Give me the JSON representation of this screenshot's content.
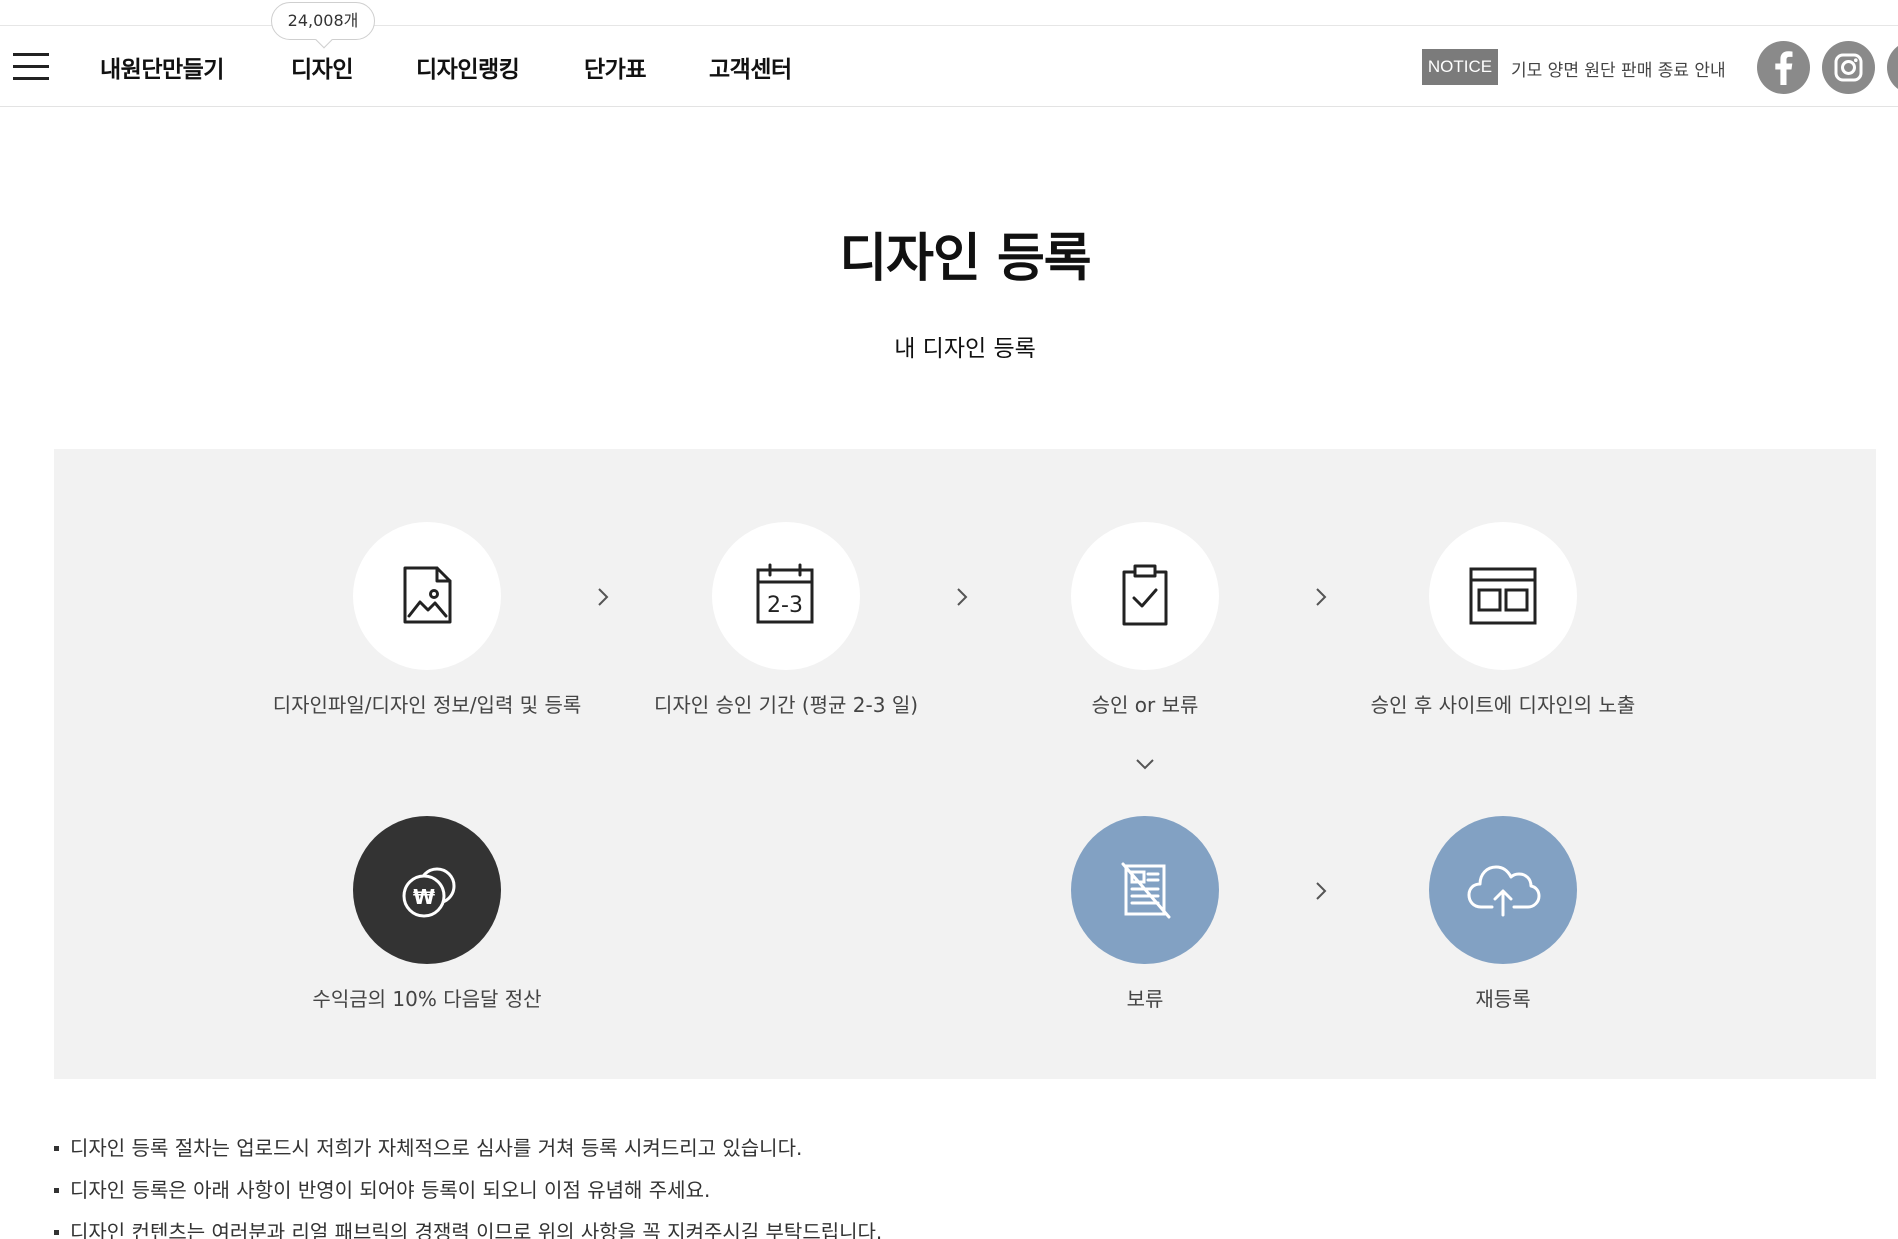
{
  "nav": {
    "items": [
      {
        "label": "내원단만들기"
      },
      {
        "label": "디자인"
      },
      {
        "label": "디자인랭킹"
      },
      {
        "label": "단가표"
      },
      {
        "label": "고객센터"
      }
    ],
    "design_count": "24,008개",
    "notice_badge": "NOTICE",
    "notice_text": "기모 양면 원단 판매 종료 안내",
    "social_icons": [
      "facebook-icon",
      "instagram-icon"
    ]
  },
  "page": {
    "title": "디자인 등록",
    "subtitle": "내 디자인 등록"
  },
  "process": {
    "steps": [
      {
        "icon": "image-file-icon",
        "label": "디자인파일/디자인 정보/입력 및 등록"
      },
      {
        "icon": "calendar-icon",
        "icon_text": "2-3",
        "label": "디자인 승인 기간 (평균 2-3 일)"
      },
      {
        "icon": "clipboard-check-icon",
        "label": "승인 or 보류"
      },
      {
        "icon": "browser-window-icon",
        "label": "승인 후 사이트에 디자인의 노출"
      },
      {
        "icon": "coins-won-icon",
        "icon_text": "₩",
        "label": "수익금의 10% 다음달 정산"
      },
      {
        "icon": "document-rejected-icon",
        "label": "보류"
      },
      {
        "icon": "cloud-upload-icon",
        "label": "재등록"
      }
    ]
  },
  "notes": [
    "디자인 등록 절차는 업로드시 저희가 자체적으로 심사를 거쳐 등록 시켜드리고 있습니다.",
    "디자인 등록은 아래 사항이 반영이 되어야 등록이 되오니 이점 유념해 주세요.",
    "디자인 컨텐츠는 여러분과 리얼 패브릭의 경쟁력 이므로 위의 사항을 꼭 지켜주시길 부탁드립니다."
  ],
  "colors": {
    "notice_badge": "#7b7b7b",
    "social": "#8a8a8a",
    "process_bg": "#f2f2f2",
    "circle_dark": "#333333",
    "circle_blue": "#82a1c3"
  }
}
